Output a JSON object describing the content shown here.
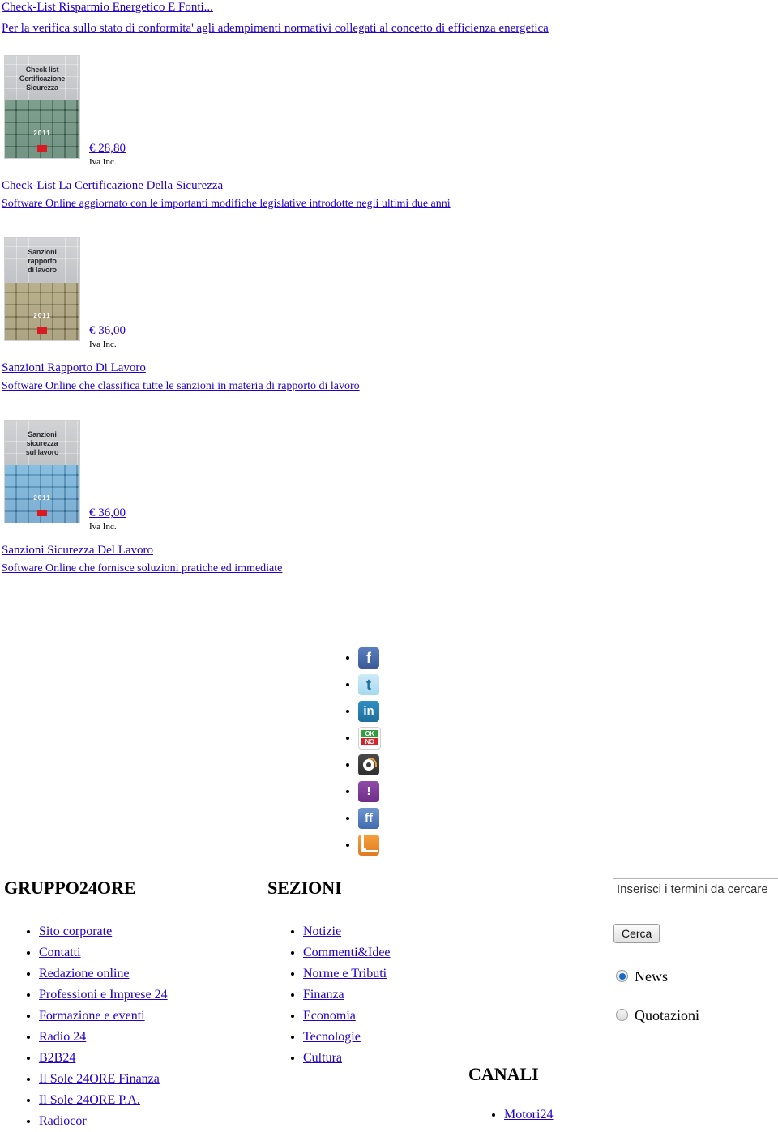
{
  "promo": {
    "title": "Check-List Risparmio Energetico E Fonti...",
    "subtitle": "Per la verifica sullo stato di conformita' agli adempimenti normativi collegati al concetto di efficienza energetica"
  },
  "products": [
    {
      "cover_caption": "Check list\nCertificazione\nSicurezza",
      "cover_year": "2011",
      "cover_color": "green",
      "price": "€ 28,80",
      "vat_note": "Iva Inc.",
      "name": "Check-List La Certificazione Della Sicurezza",
      "description": "Software Online aggiornato con le importanti modifiche legislative introdotte negli ultimi due anni"
    },
    {
      "cover_caption": "Sanzioni\nrapporto\ndi lavoro",
      "cover_year": "2011",
      "cover_color": "olive",
      "price": "€ 36,00",
      "vat_note": "Iva Inc.",
      "name": "Sanzioni Rapporto Di Lavoro",
      "description": "Software Online che classifica tutte le sanzioni in materia di rapporto di lavoro"
    },
    {
      "cover_caption": "Sanzioni\nsicurezza\nsul lavoro",
      "cover_year": "2011",
      "cover_color": "blue",
      "price": "€ 36,00",
      "vat_note": "Iva Inc.",
      "name": "Sanzioni Sicurezza Del Lavoro",
      "description": "Software Online che fornisce soluzioni pratiche ed immediate"
    }
  ],
  "social": [
    {
      "icon": "facebook-icon",
      "glyph": "f"
    },
    {
      "icon": "twitter-icon",
      "glyph": "t"
    },
    {
      "icon": "linkedin-icon",
      "glyph": "in"
    },
    {
      "icon": "oknotizie-icon",
      "glyph": ""
    },
    {
      "icon": "wikio-icon",
      "glyph": ""
    },
    {
      "icon": "yahoo-icon",
      "glyph": "!"
    },
    {
      "icon": "friendfeed-icon",
      "glyph": "ff"
    },
    {
      "icon": "rss-icon",
      "glyph": ""
    }
  ],
  "footer": {
    "gruppo24ore": {
      "heading": "GRUPPO24ORE",
      "items": [
        "Sito corporate",
        "Contatti",
        "Redazione online",
        "Professioni e Imprese 24",
        "Formazione e eventi",
        "Radio 24",
        "B2B24",
        "Il Sole 24ORE Finanza",
        "Il Sole 24ORE P.A.",
        "Radiocor"
      ]
    },
    "sezioni": {
      "heading": "SEZIONI",
      "items": [
        "Notizie",
        "Commenti&Idee",
        "Norme e Tributi",
        "Finanza",
        "Economia",
        "Tecnologie",
        "Cultura"
      ]
    },
    "canali": {
      "heading": "CANALI",
      "items": [
        "Motori24"
      ]
    }
  },
  "search": {
    "value": "Inserisci i termini da cercare",
    "placeholder": "Inserisci i termini da cercare",
    "button_label": "Cerca",
    "options": [
      {
        "label": "News",
        "selected": true
      },
      {
        "label": "Quotazioni",
        "selected": false
      }
    ]
  },
  "colors": {
    "link": "#2200cc",
    "text": "#000000",
    "background": "#ffffff",
    "radio_selected": "#1769c4"
  }
}
